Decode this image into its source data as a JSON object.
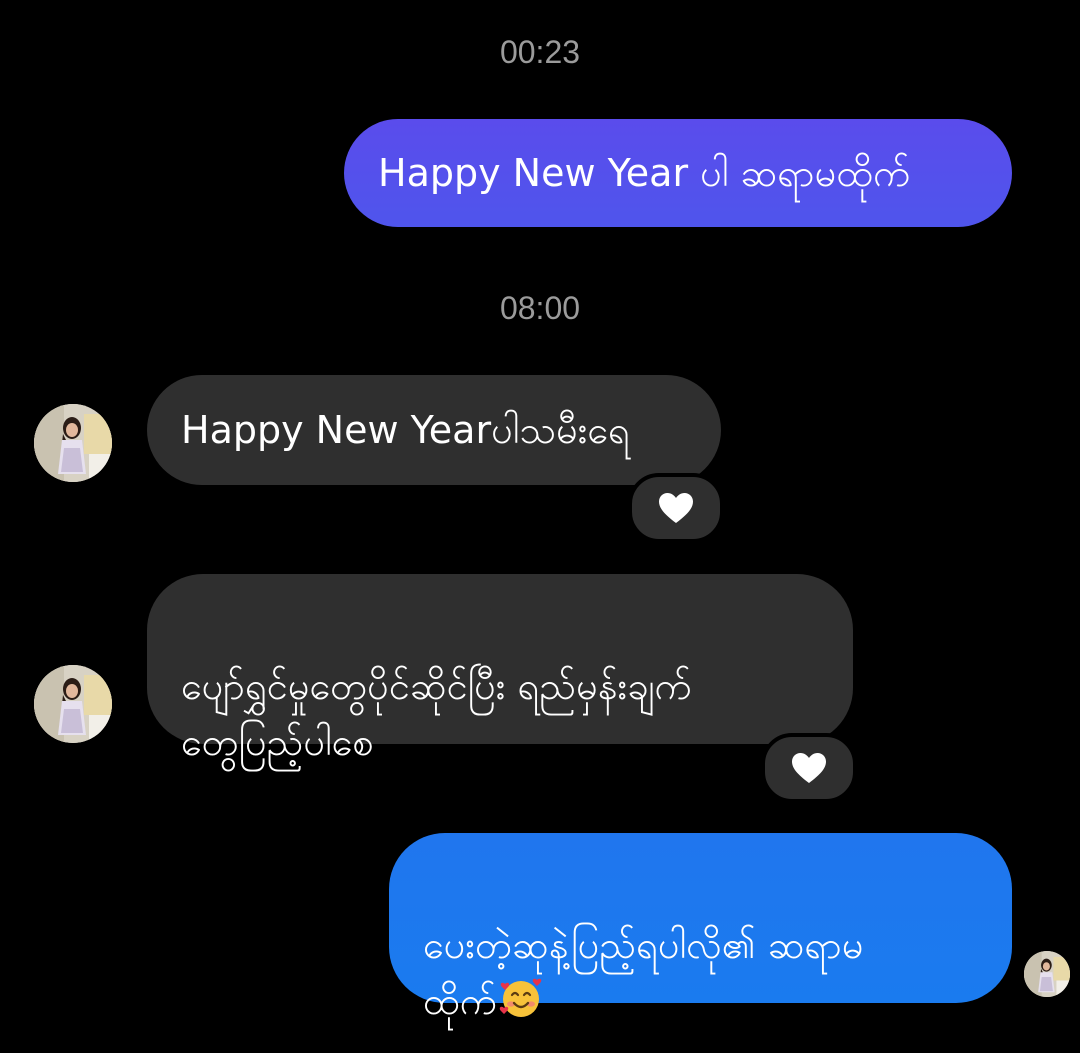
{
  "colors": {
    "background": "#000000",
    "timestamp": "#9b9b9b",
    "received_bubble": "#2f2f2f",
    "sent_gradient_top": "#5a4cec",
    "sent_gradient_bottom": "#1a7bef"
  },
  "messages": [
    {
      "type": "timestamp",
      "text": "00:23"
    },
    {
      "type": "sent",
      "text": "Happy New Year ပါ ဆရာမထိုက်"
    },
    {
      "type": "timestamp",
      "text": "08:00"
    },
    {
      "type": "received",
      "text": "Happy New Yearပါသမီးရေ",
      "reaction": "white-heart-icon"
    },
    {
      "type": "received",
      "text": "ပျော်ရွှင်မှုတွေပိုင်ဆိုင်ပြီး ရည်မှန်းချက်\nတွေပြည့်ပါစေ",
      "reaction": "white-heart-icon"
    },
    {
      "type": "sent",
      "text": "ပေးတဲ့ဆုနဲ့ပြည့်ရပါလို၏ ဆရာမ\nထိုက်",
      "emoji": "smiling-face-with-hearts-icon"
    }
  ]
}
